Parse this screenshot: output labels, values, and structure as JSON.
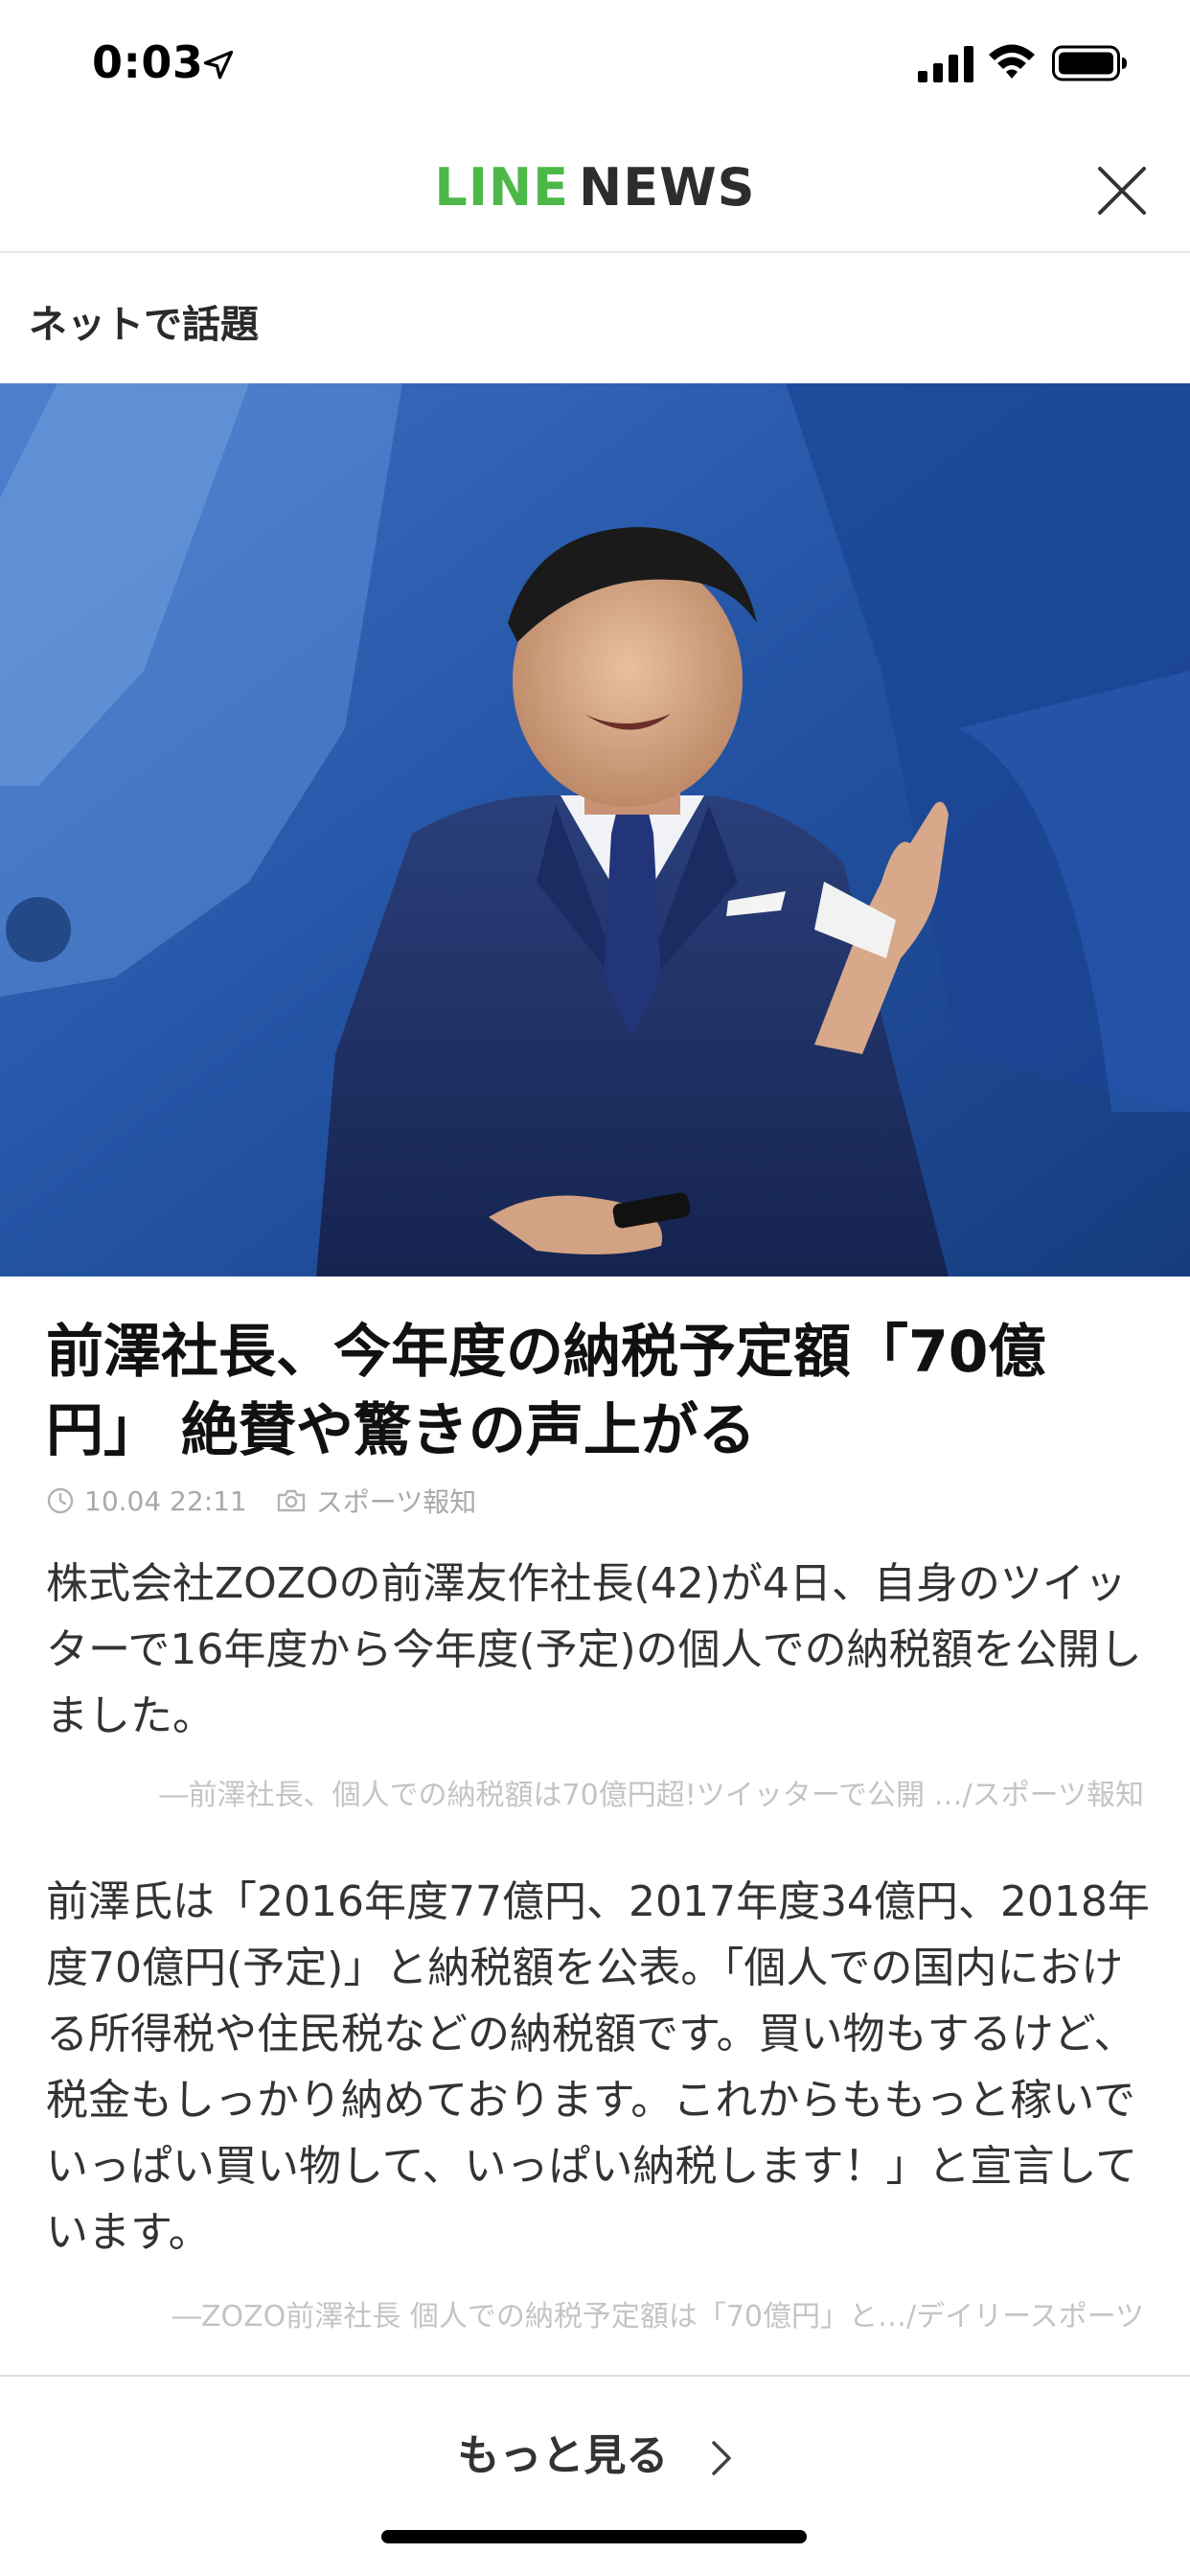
{
  "status_bar": {
    "time": "0:03",
    "icons": [
      "location-arrow-icon",
      "signal-icon",
      "wifi-icon",
      "battery-icon"
    ]
  },
  "header": {
    "logo_line": "LINE",
    "logo_news": "NEWS",
    "close_icon": "close-icon",
    "colors": {
      "line_green": "#4cb848",
      "news_dark": "#2d2d2d"
    }
  },
  "category": "ネットで話題",
  "article": {
    "title": "前澤社長、今年度の納税予定額「70億円」 絶賛や驚きの声上がる",
    "time": "10.04 22:11",
    "source": "スポーツ報知",
    "paragraph1": "株式会社ZOZOの前澤友作社長(42)が4日、自身のツイッターで16年度から今年度(予定)の個人での納税額を公開しました。",
    "citation1": "―前澤社長、個人での納税額は70億円超!ツイッターで公開 …/スポーツ報知",
    "paragraph2": "前澤氏は「2016年度77億円、2017年度34億円、2018年度70億円(予定)」と納税額を公表。「個人での国内における所得税や住民税などの納税額です。買い物もするけど、税金もしっかり納めております。これからももっと稼いでいっぱい買い物して、いっぱい納税します！」と宣言しています。",
    "citation2": "―ZOZO前澤社長 個人での納税予定額は「70億円」と…/デイリースポーツ"
  },
  "footer": {
    "more_label": "もっと見る"
  }
}
